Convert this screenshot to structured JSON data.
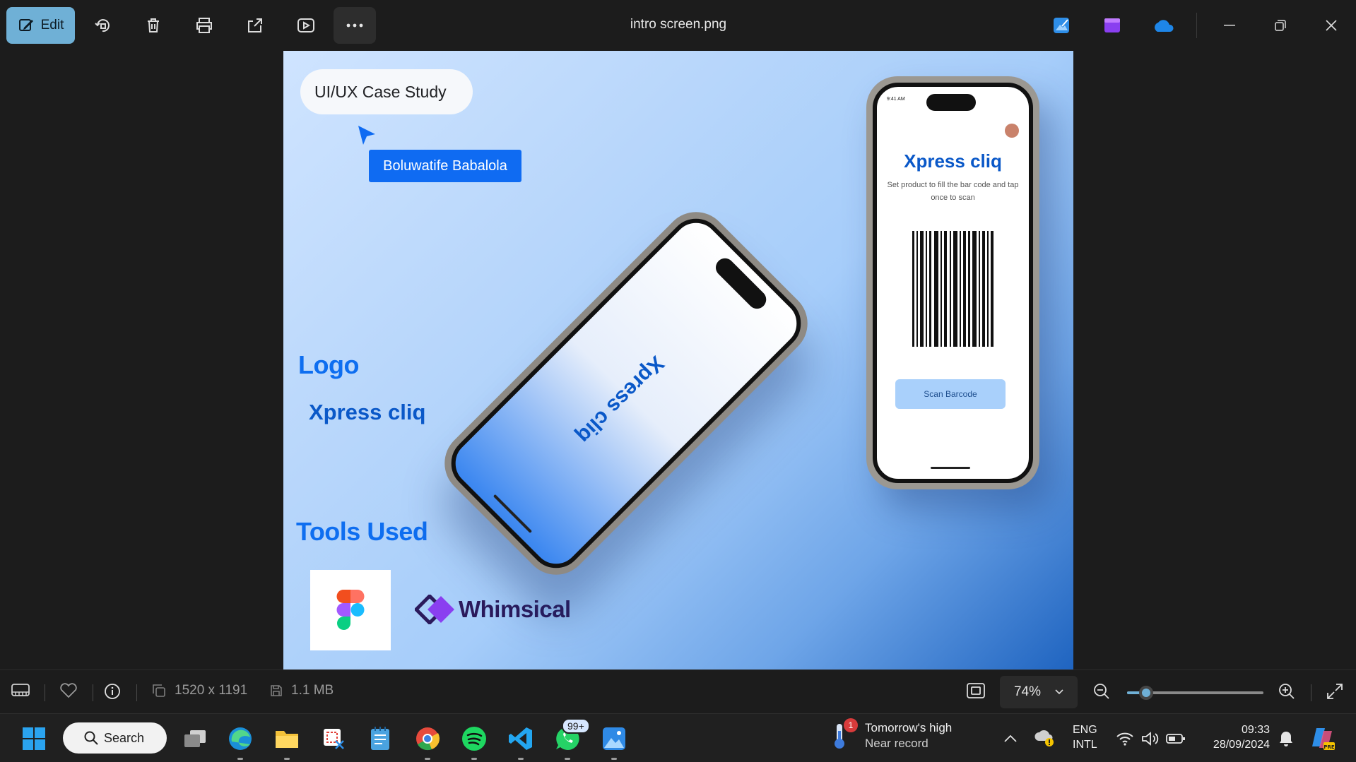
{
  "toolbar": {
    "edit_label": "Edit",
    "file_name": "intro screen.png"
  },
  "image": {
    "pill_text": "UI/UX Case Study",
    "author": "Boluwatife Babalola",
    "logo_heading": "Logo",
    "logo_text": "Xpress cliq",
    "tools_heading": "Tools Used",
    "tool_names": [
      "Whimsical"
    ],
    "phone_brand": "Xpress cliq",
    "phone_time": "9:41 AM",
    "phone_description": "Set product to fill the bar code and tap once to scan",
    "scan_button": "Scan Barcode"
  },
  "statusbar": {
    "dimensions": "1520 x 1191",
    "file_size": "1.1 MB",
    "zoom": "74%",
    "zoom_level": 0.14
  },
  "taskbar": {
    "search_label": "Search",
    "whatsapp_badge": "99+",
    "weather_alert_count": "1",
    "weather_line1": "Tomorrow's high",
    "weather_line2": "Near record",
    "lang_line1": "ENG",
    "lang_line2": "INTL",
    "time": "09:33",
    "date": "28/09/2024"
  },
  "colors": {
    "accent": "#6fb0d6",
    "brand_blue": "#0e6ef0"
  }
}
